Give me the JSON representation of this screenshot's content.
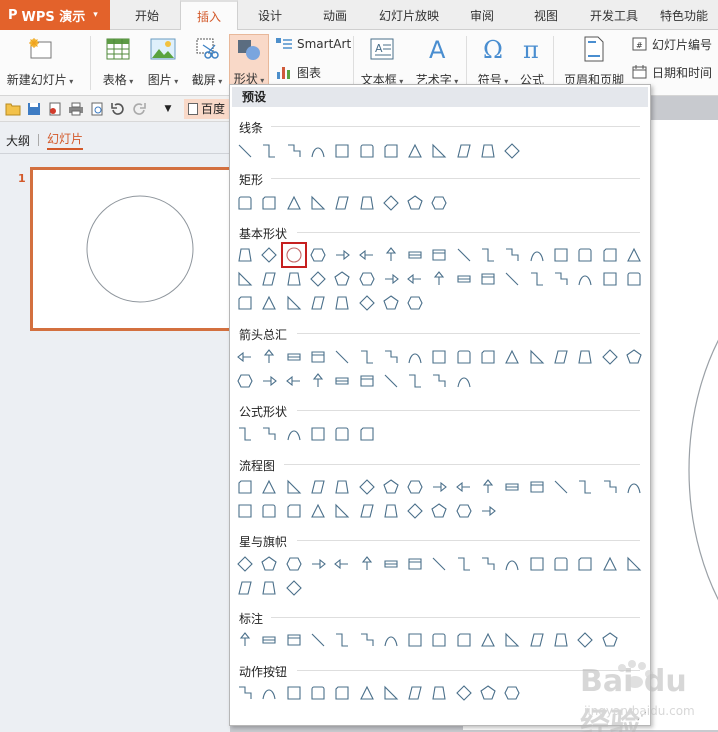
{
  "app": {
    "title": "WPS 演示"
  },
  "tabs": [
    {
      "label": "开始"
    },
    {
      "label": "插入",
      "active": true
    },
    {
      "label": "设计"
    },
    {
      "label": "动画"
    },
    {
      "label": "幻灯片放映"
    },
    {
      "label": "审阅"
    },
    {
      "label": "视图"
    },
    {
      "label": "开发工具"
    },
    {
      "label": "特色功能"
    }
  ],
  "ribbon": {
    "new_slide": "新建幻灯片",
    "table": "表格",
    "picture": "图片",
    "screenshot": "截屏",
    "shape": "形状",
    "smartart": "SmartArt",
    "chart": "图表",
    "textbox": "文本框",
    "wordart": "艺术字",
    "symbol": "符号",
    "formula": "公式",
    "header_footer": "页眉和页脚",
    "slide_number": "幻灯片编号",
    "date_time": "日期和时间"
  },
  "quickbar": {
    "baidu_label": "百度"
  },
  "panel": {
    "tab_outline": "大纲",
    "tab_slides": "幻灯片",
    "slide_number": "1"
  },
  "dropdown": {
    "preset_label": "预设",
    "sections": [
      {
        "title": "线条",
        "count": 12
      },
      {
        "title": "矩形",
        "count": 9
      },
      {
        "title": "基本形状",
        "count": 42
      },
      {
        "title": "箭头总汇",
        "count": 27
      },
      {
        "title": "公式形状",
        "count": 6
      },
      {
        "title": "流程图",
        "count": 28
      },
      {
        "title": "星与旗帜",
        "count": 20
      },
      {
        "title": "标注",
        "count": 16
      },
      {
        "title": "动作按钮",
        "count": 12
      }
    ],
    "selected_shape": "oval"
  },
  "colors": {
    "accent": "#d3592a",
    "app_button": "#e3622b",
    "shape_stroke": "#4a6f8a",
    "selection_border": "#c62020"
  },
  "watermark": {
    "brand": "Bai du 经验",
    "sub": "jingyan.baidu.com"
  }
}
